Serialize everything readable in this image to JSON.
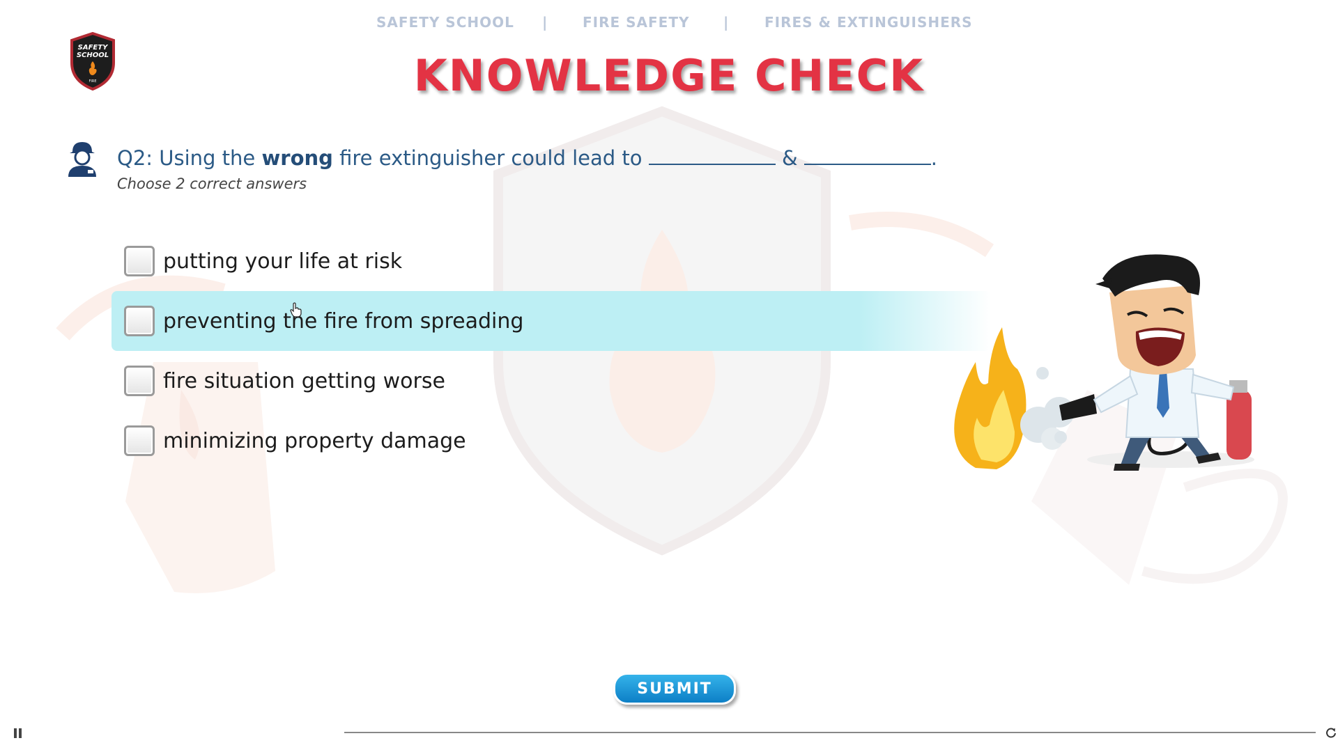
{
  "breadcrumb": {
    "item1": "SAFETY SCHOOL",
    "sep": "|",
    "item2": "FIRE SAFETY",
    "item3": "FIRES & EXTINGUISHERS"
  },
  "logo": {
    "line1": "SAFETY",
    "line2": "SCHOOL",
    "line3": "FIRE"
  },
  "title": "KNOWLEDGE CHECK",
  "question": {
    "prefix": "Q2: Using the ",
    "emphasis": "wrong",
    "middle": " fire extinguisher could lead to ",
    "conjunction": " & ",
    "end": ".",
    "instruction": "Choose 2 correct answers"
  },
  "options": [
    {
      "label": "putting your life at risk",
      "checked": false
    },
    {
      "label": "preventing the fire from spreading",
      "checked": false,
      "hovered": true
    },
    {
      "label": "fire situation getting worse",
      "checked": false
    },
    {
      "label": "minimizing property damage",
      "checked": false
    }
  ],
  "submit_label": "SUBMIT",
  "colors": {
    "title": "#e33344",
    "question": "#2b5a86",
    "hover_row": "#bdeff4",
    "submit": "#1a95d8",
    "breadcrumb": "#b9c5d8"
  },
  "icons": {
    "logo": "safety-school-shield-logo",
    "question": "firefighter-icon",
    "player_pause": "pause-icon",
    "player_replay": "replay-icon",
    "cursor": "hand-pointer-icon"
  }
}
